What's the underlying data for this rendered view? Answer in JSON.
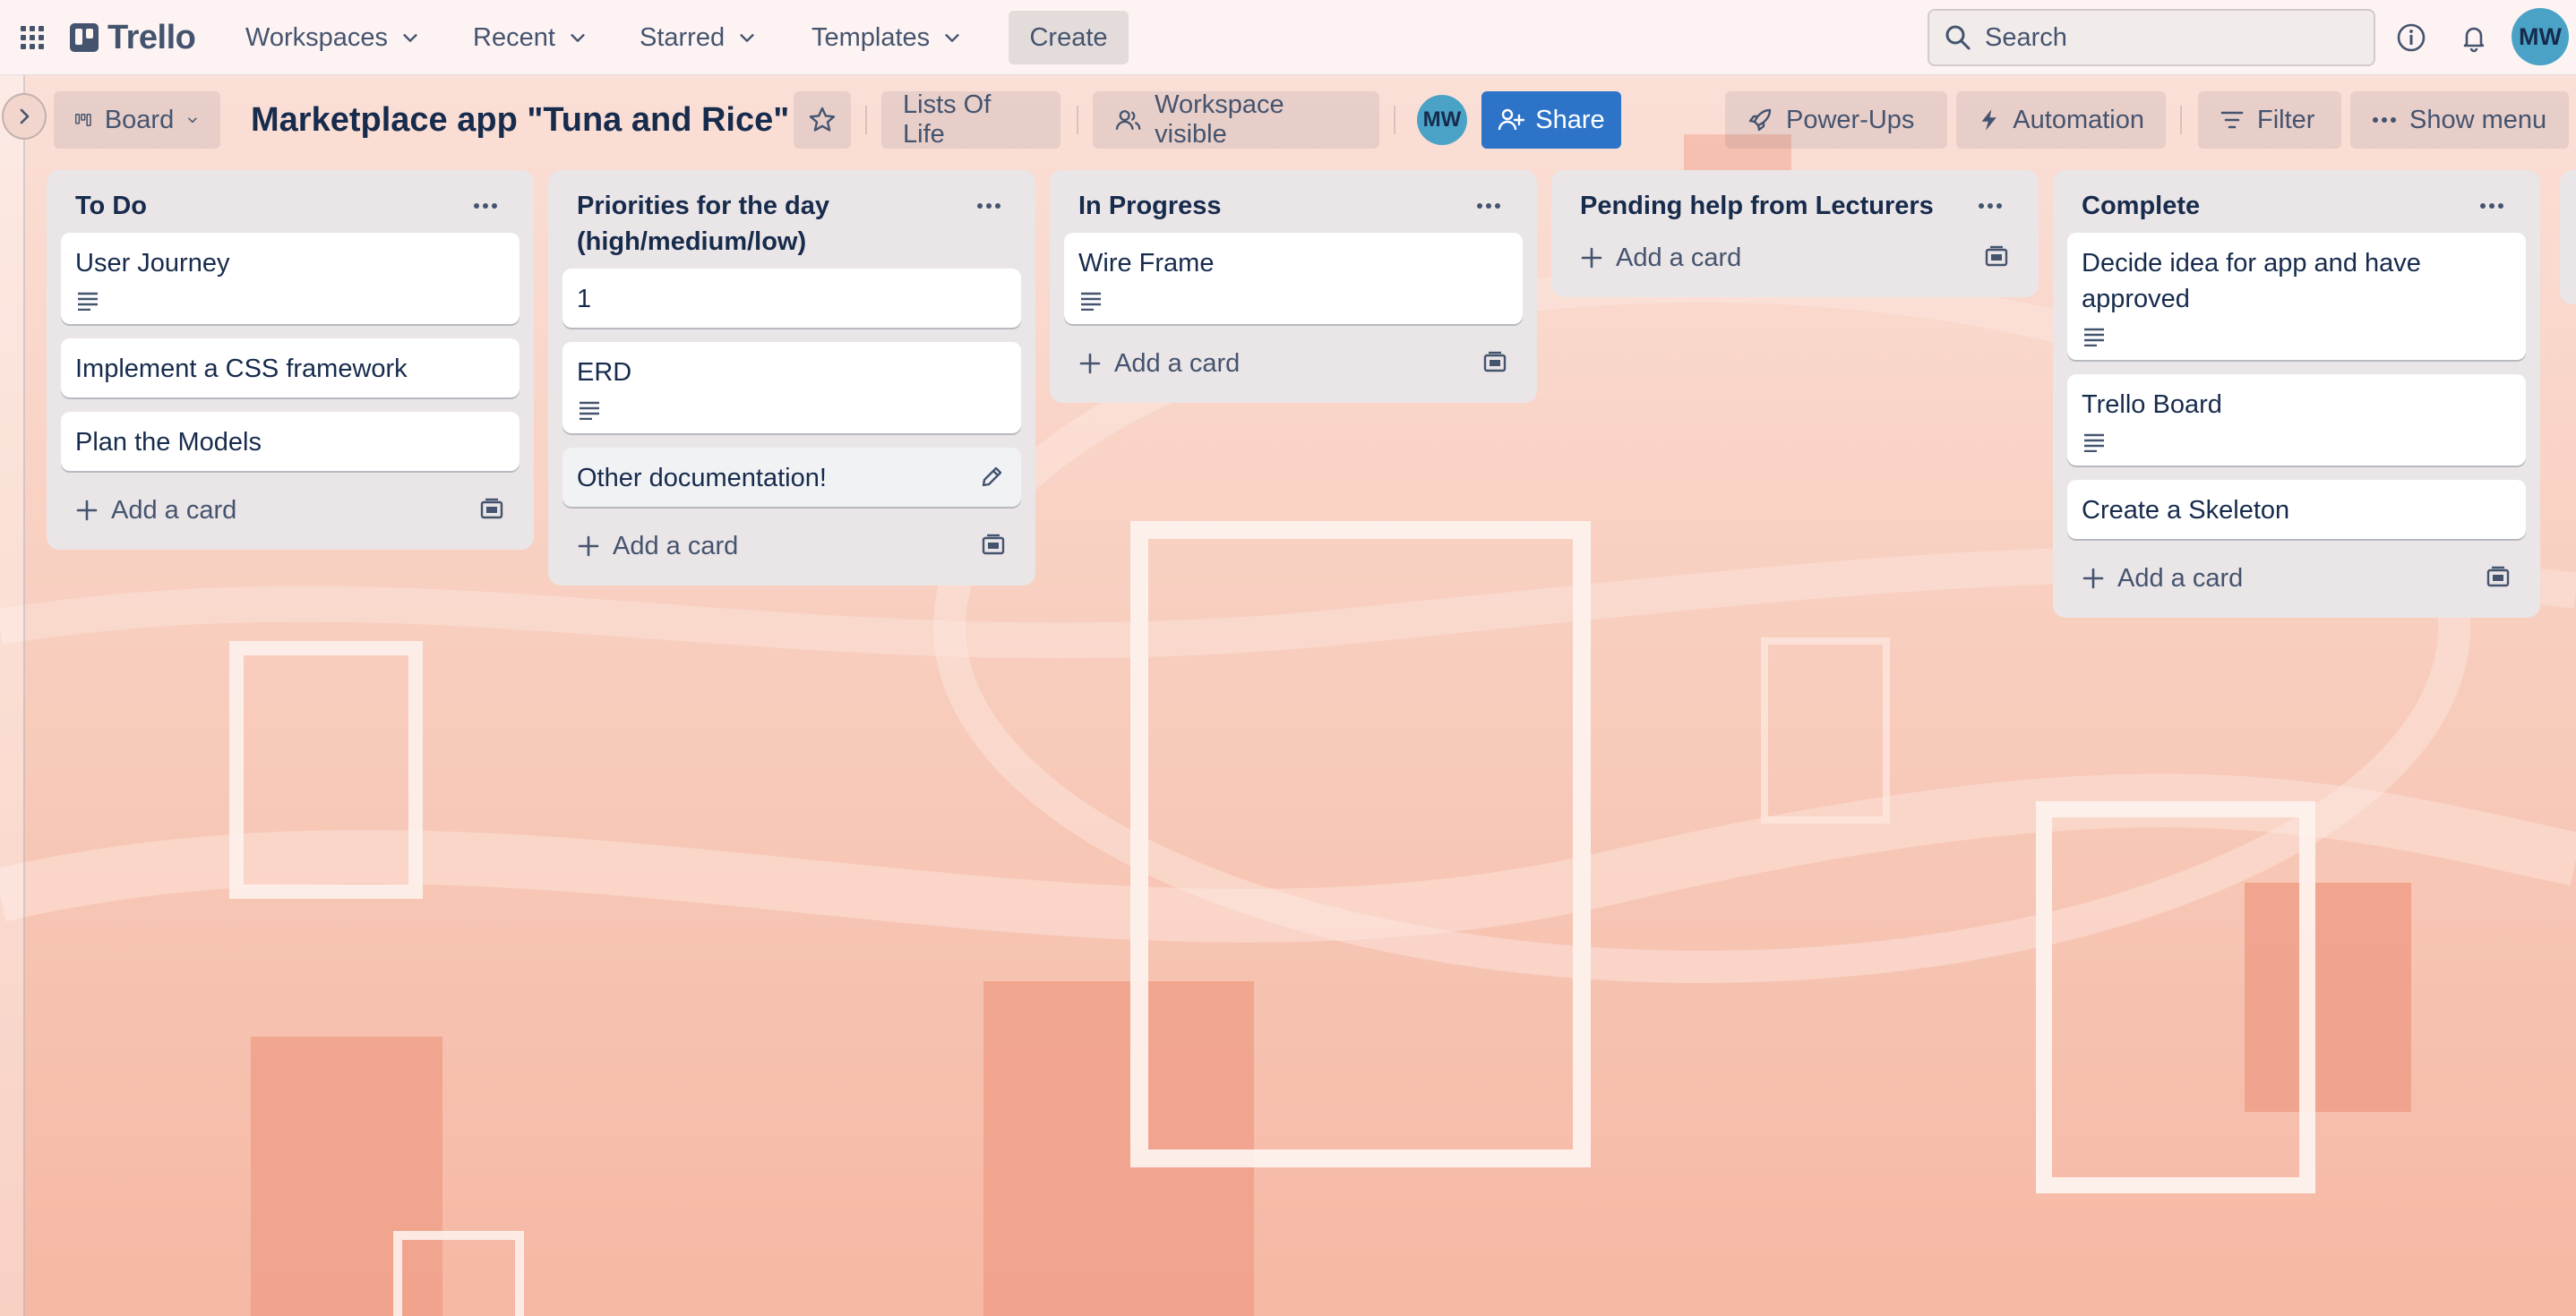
{
  "nav": {
    "logo": "Trello",
    "menus": [
      "Workspaces",
      "Recent",
      "Starred",
      "Templates"
    ],
    "create_label": "Create",
    "search_placeholder": "Search",
    "user_initials": "MW"
  },
  "board": {
    "view_label": "Board",
    "title": "Marketplace app \"Tuna and Rice\"",
    "workspace_name": "Lists Of Life",
    "visibility_label": "Workspace visible",
    "member_initials": "MW",
    "share_label": "Share",
    "powerups_label": "Power-Ups",
    "automation_label": "Automation",
    "filter_label": "Filter",
    "show_menu_label": "Show menu"
  },
  "lists": [
    {
      "title": "To Do",
      "cards": [
        {
          "title": "User Journey",
          "has_description": true
        },
        {
          "title": "Implement a CSS framework",
          "has_description": false
        },
        {
          "title": "Plan the Models",
          "has_description": false
        }
      ],
      "add_label": "Add a card"
    },
    {
      "title": "Priorities for the day (high/medium/low)",
      "cards": [
        {
          "title": "1",
          "has_description": false
        },
        {
          "title": "ERD",
          "has_description": true
        },
        {
          "title": "Other documentation!",
          "has_description": false,
          "hovered": true
        }
      ],
      "add_label": "Add a card"
    },
    {
      "title": "In Progress",
      "cards": [
        {
          "title": "Wire Frame",
          "has_description": true
        }
      ],
      "add_label": "Add a card"
    },
    {
      "title": "Pending help from Lecturers",
      "cards": [],
      "add_label": "Add a card"
    },
    {
      "title": "Complete",
      "cards": [
        {
          "title": "Decide idea for app and have approved",
          "has_description": true
        },
        {
          "title": "Trello Board",
          "has_description": true
        },
        {
          "title": "Create a Skeleton",
          "has_description": false
        }
      ],
      "add_label": "Add a card"
    }
  ],
  "colors": {
    "background": "#f8cfbf",
    "accent": "#2d74c9",
    "list_bg": "#eae5e6",
    "avatar": "#4aa3c7"
  }
}
